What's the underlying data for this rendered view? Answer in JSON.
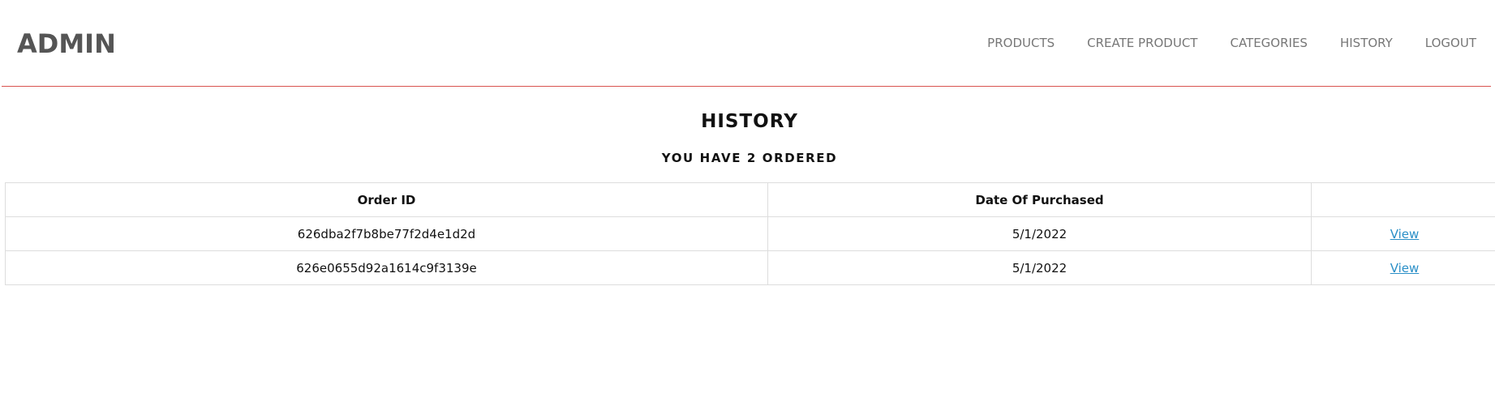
{
  "header": {
    "logo": "ADMIN",
    "nav": [
      {
        "label": "PRODUCTS"
      },
      {
        "label": "CREATE PRODUCT"
      },
      {
        "label": "CATEGORIES"
      },
      {
        "label": "HISTORY"
      },
      {
        "label": "LOGOUT"
      }
    ],
    "divider_color": "#d9534f"
  },
  "main": {
    "title": "HISTORY",
    "subtitle": "YOU HAVE 2 ORDERED",
    "table": {
      "columns": [
        "Order ID",
        "Date Of Purchased",
        ""
      ],
      "rows": [
        {
          "order_id": "626dba2f7b8be77f2d4e1d2d",
          "date": "5/1/2022",
          "action": "View"
        },
        {
          "order_id": "626e0655d92a1614c9f3139e",
          "date": "5/1/2022",
          "action": "View"
        }
      ]
    }
  },
  "colors": {
    "link": "#2a8fc7",
    "nav_text": "#777777",
    "logo_text": "#555555"
  }
}
